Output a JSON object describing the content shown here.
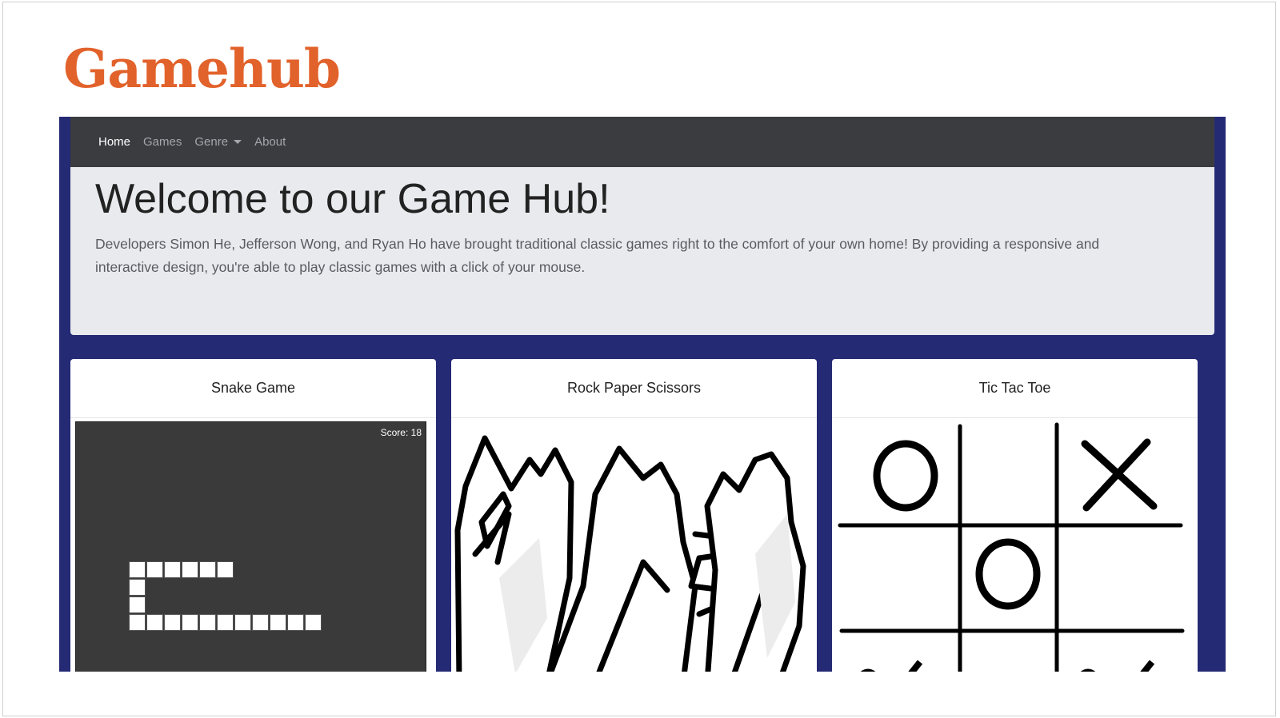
{
  "brand": {
    "title": "Gamehub",
    "color": "#e2622b"
  },
  "nav": {
    "items": [
      {
        "label": "Home",
        "active": true
      },
      {
        "label": "Games",
        "active": false
      },
      {
        "label": "Genre",
        "active": false,
        "dropdown": true
      },
      {
        "label": "About",
        "active": false
      }
    ]
  },
  "hero": {
    "title": "Welcome to our Game Hub!",
    "description": "Developers Simon He, Jefferson Wong, and Ryan Ho have brought traditional classic games right to the comfort of your own home! By providing a responsive and interactive design, you're able to play classic games with a click of your mouse."
  },
  "cards": [
    {
      "title": "Snake Game",
      "score_text": "Score: 18"
    },
    {
      "title": "Rock Paper Scissors"
    },
    {
      "title": "Tic Tac Toe"
    }
  ],
  "colors": {
    "frame": "#252a74",
    "navbar": "#3b3c40",
    "jumbotron": "#e9eaee",
    "snake_board": "#3a3a3a"
  }
}
